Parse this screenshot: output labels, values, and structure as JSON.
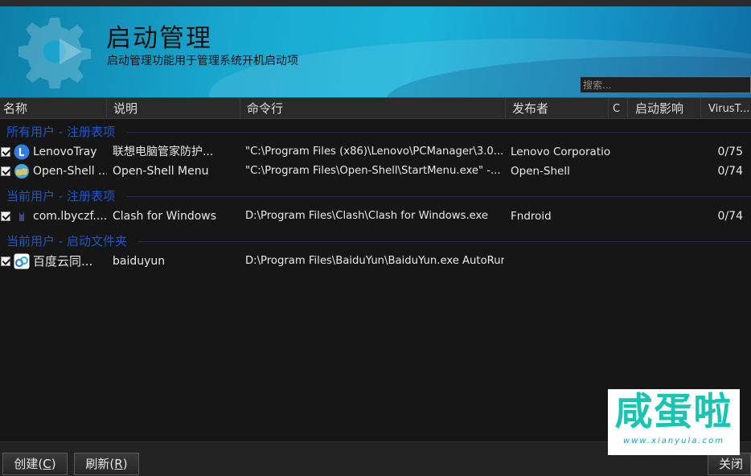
{
  "header": {
    "title": "启动管理",
    "subtitle": "启动管理功能用于管理系统开机启动项",
    "search_placeholder": "搜索..."
  },
  "columns": [
    "名称",
    "说明",
    "命令行",
    "发布者",
    "C",
    "启动影响",
    "VirusT..."
  ],
  "groups": [
    {
      "label": "所有用户 - 注册表项",
      "rows": [
        {
          "checked": true,
          "icon": "lenovo-icon",
          "name": "LenovoTray",
          "description": "联想电脑管家防护...",
          "command": "\"C:\\Program Files (x86)\\Lenovo\\PCManager\\3.0...",
          "publisher": "Lenovo Corporation",
          "virustotal": "0/75"
        },
        {
          "checked": true,
          "icon": "globe-icon",
          "name": "Open-Shell ...",
          "description": "Open-Shell Menu",
          "command": "\"C:\\Program Files\\Open-Shell\\StartMenu.exe\" -...",
          "publisher": "Open-Shell",
          "virustotal": "0/74"
        }
      ]
    },
    {
      "label": "当前用户 - 注册表项",
      "rows": [
        {
          "checked": true,
          "icon": "clash-cat-icon",
          "name": "com.lbyczf....",
          "description": "Clash for Windows",
          "command": "D:\\Program Files\\Clash\\Clash for Windows.exe",
          "publisher": "Fndroid",
          "virustotal": "0/74"
        }
      ]
    },
    {
      "label": "当前用户 - 启动文件夹",
      "rows": [
        {
          "checked": true,
          "icon": "baidu-cloud-icon",
          "name": "百度云同...",
          "description": "baiduyun",
          "command": "D:\\Program Files\\BaiduYun\\BaiduYun.exe AutoRun",
          "publisher": "",
          "virustotal": ""
        }
      ]
    }
  ],
  "footer": {
    "create_label": "创建",
    "create_key": "C",
    "refresh_label": "刷新",
    "refresh_key": "R",
    "close_label": "关闭"
  },
  "watermark": {
    "text": "咸蛋啦",
    "url": "www.xianyula.com"
  },
  "colors": {
    "group_text": "#1f55c8",
    "header_blue": "#19a7cf",
    "watermark_teal": "#19c4b2"
  }
}
